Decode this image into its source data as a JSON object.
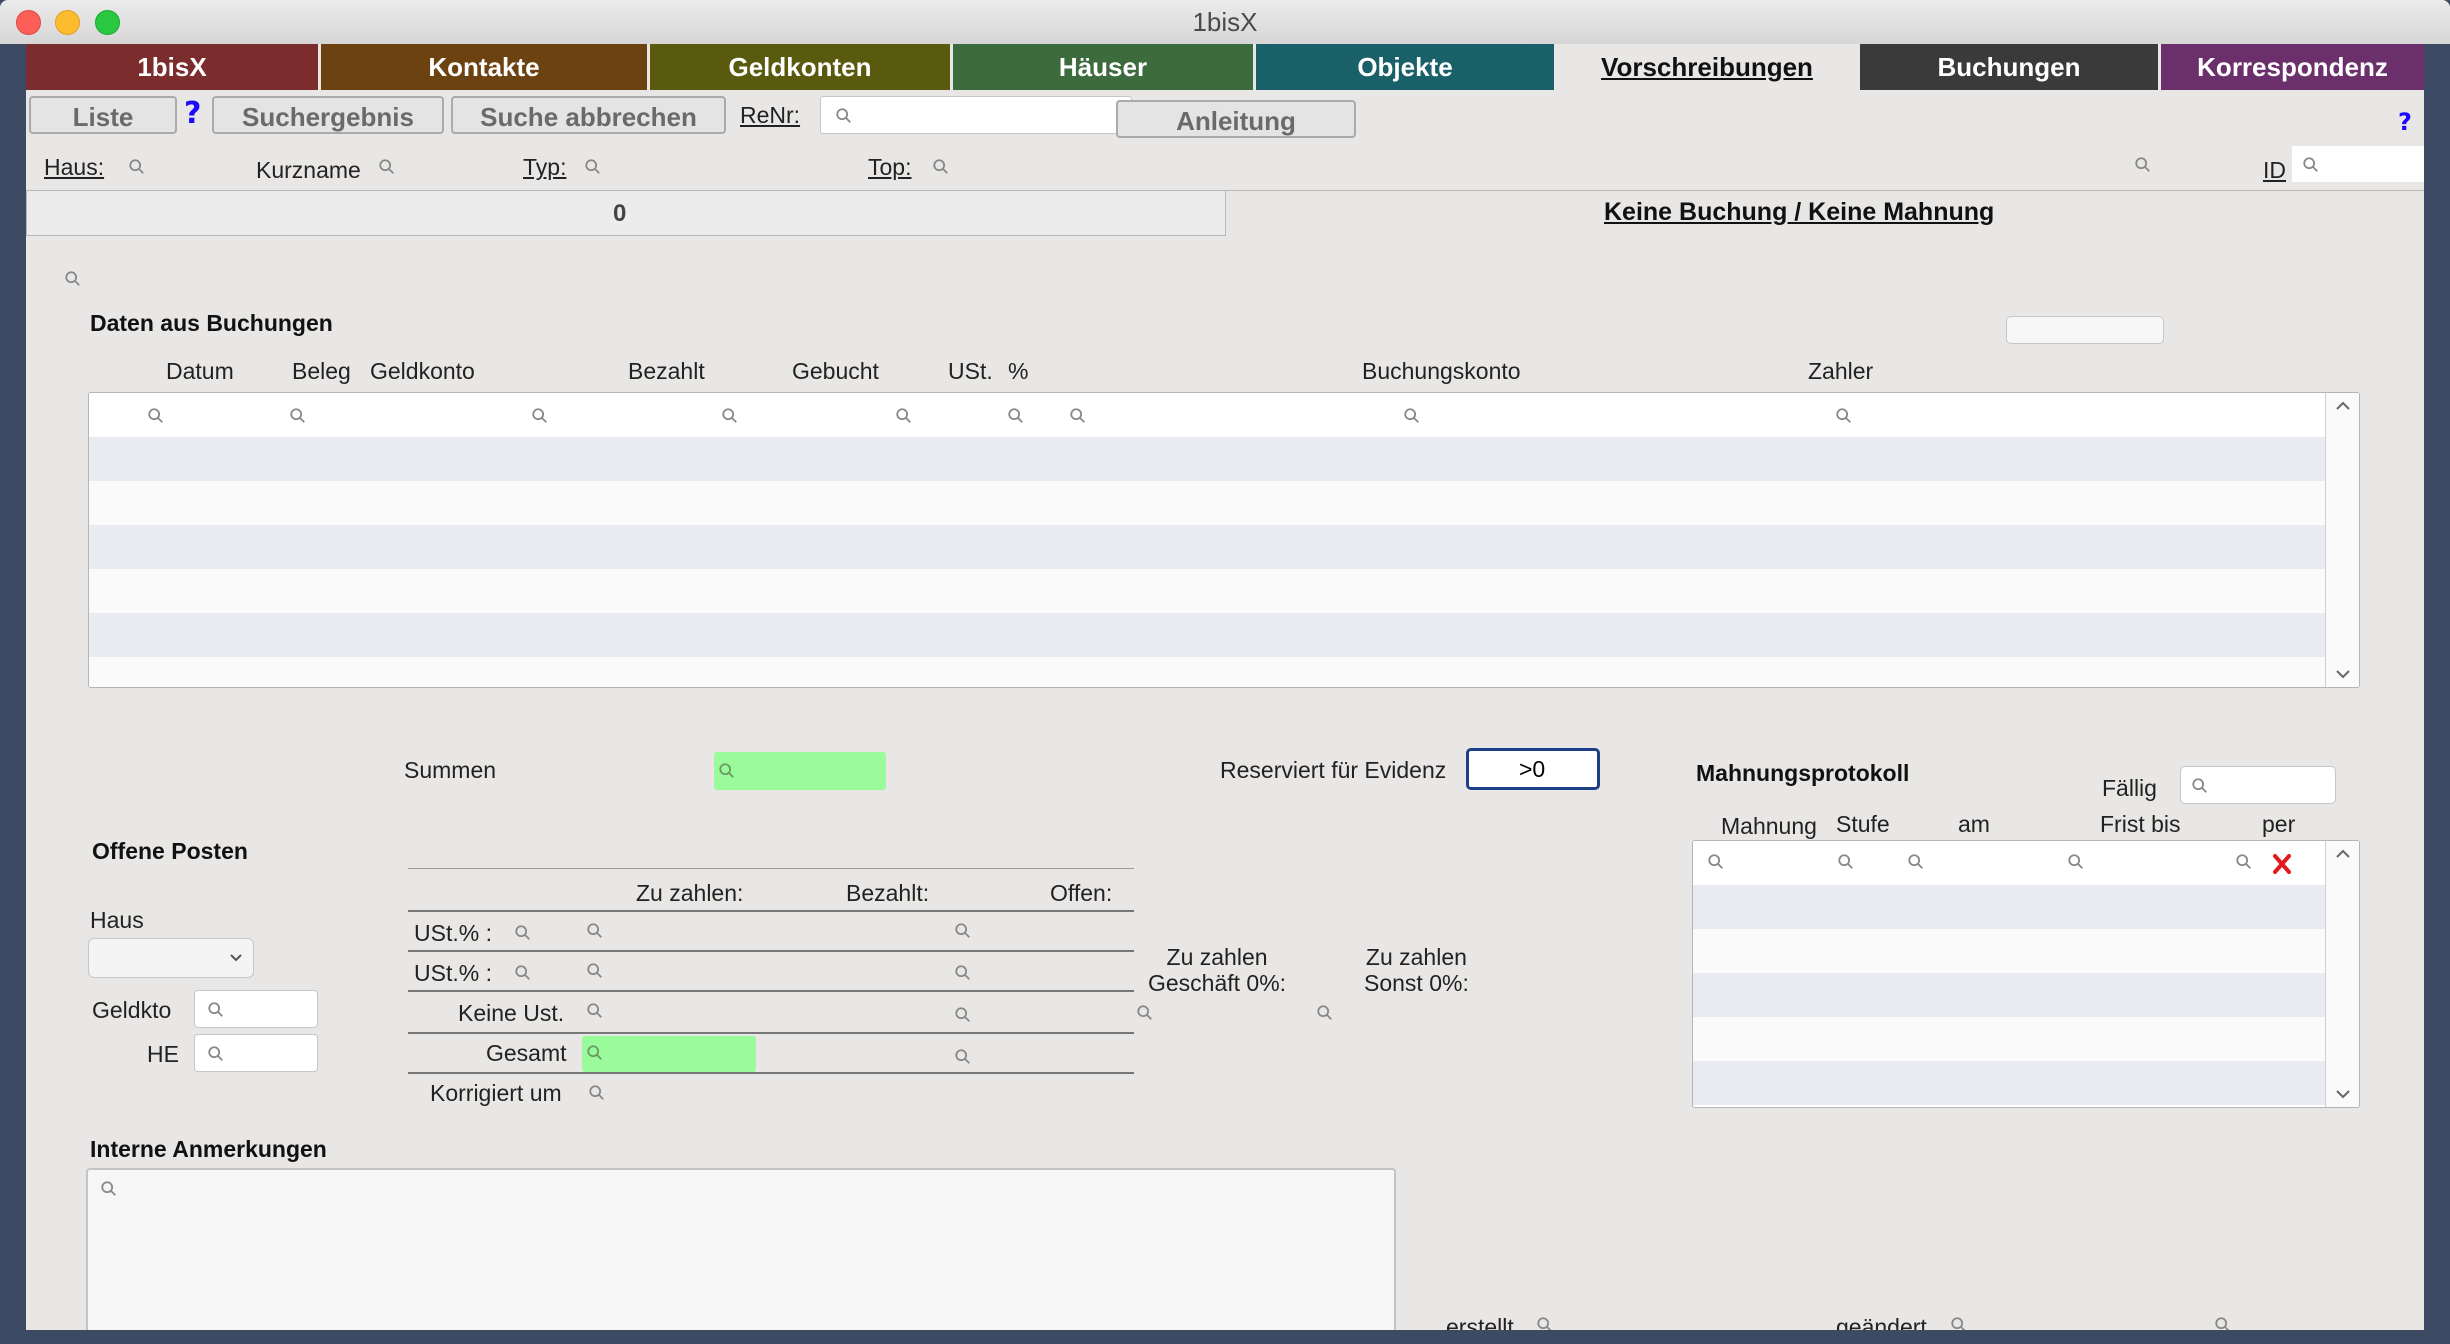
{
  "window": {
    "title": "1bisX"
  },
  "tabs": [
    {
      "label": "1bisX",
      "color": "#7b2c2c"
    },
    {
      "label": "Kontakte",
      "color": "#6b4210"
    },
    {
      "label": "Geldkonten",
      "color": "#5a5a0e"
    },
    {
      "label": "Häuser",
      "color": "#3c6b3e"
    },
    {
      "label": "Objekte",
      "color": "#1a6069"
    },
    {
      "label": "Vorschreibungen",
      "color": "#e9e7e5",
      "active": true
    },
    {
      "label": "Buchungen",
      "color": "#3a3a3a"
    },
    {
      "label": "Korrespondenz",
      "color": "#6b2f6b"
    }
  ],
  "toolbar": {
    "liste": "Liste",
    "help": "?",
    "suchergebnis": "Suchergebnis",
    "suche_abbrechen": "Suche abbrechen",
    "renr_label": "ReNr:",
    "anleitung": "Anleitung"
  },
  "filters": {
    "haus": "Haus:",
    "kurzname": "Kurzname",
    "typ": "Typ:",
    "top": "Top:",
    "id": "ID"
  },
  "status": {
    "count": "0",
    "message": "Keine Buchung / Keine Mahnung"
  },
  "bookings": {
    "title": "Daten aus Buchungen",
    "columns": [
      "Datum",
      "Beleg",
      "Geldkonto",
      "Bezahlt",
      "Gebucht",
      "USt.",
      "%",
      "Buchungskonto",
      "Zahler"
    ],
    "summen_label": "Summen",
    "reserviert_label": "Reserviert für Evidenz",
    "reserviert_value": ">0"
  },
  "open_items": {
    "title": "Offene Posten",
    "haus_label": "Haus",
    "geldkto_label": "Geldkto",
    "he_label": "HE",
    "headers": [
      "Zu zahlen:",
      "Bezahlt:",
      "Offen:"
    ],
    "rows": [
      "USt.% :",
      "USt.% :",
      "Keine Ust.",
      "Gesamt",
      "Korrigiert um"
    ],
    "zu_zahlen_geschaeft": "Zu zahlen\nGeschäft 0%:",
    "zu_zahlen_sonst": "Zu zahlen\nSonst 0%:"
  },
  "dunning": {
    "title": "Mahnungsprotokoll",
    "faellig_label": "Fällig",
    "columns": [
      "Mahnung",
      "Stufe",
      "am",
      "Frist bis",
      "per"
    ]
  },
  "notes": {
    "title": "Interne Anmerkungen"
  },
  "footer": {
    "erstellt": "erstellt",
    "geaendert": "geändert"
  }
}
